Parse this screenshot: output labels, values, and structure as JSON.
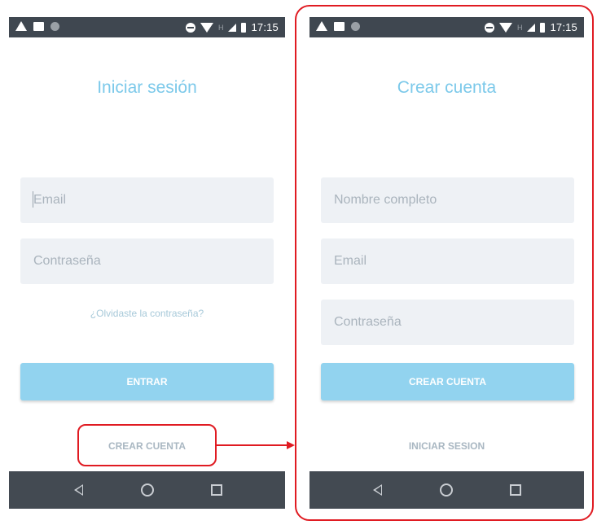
{
  "status_bar": {
    "time": "17:15",
    "network_label": "H"
  },
  "login": {
    "title": "Iniciar sesión",
    "email_placeholder": "Email",
    "password_placeholder": "Contraseña",
    "forgot_link": "¿Olvidaste la contraseña?",
    "submit_label": "ENTRAR",
    "create_account_label": "CREAR CUENTA"
  },
  "register": {
    "title": "Crear cuenta",
    "name_placeholder": "Nombre completo",
    "email_placeholder": "Email",
    "password_placeholder": "Contraseña",
    "submit_label": "CREAR CUENTA",
    "sign_in_label": "INICIAR SESION"
  },
  "nav_icons": [
    "back-icon",
    "home-icon",
    "recents-icon"
  ],
  "colors": {
    "accent": "#92d3ef",
    "title": "#7cc9ea",
    "status_bar": "#3f4750",
    "annotation": "#e01b22"
  }
}
